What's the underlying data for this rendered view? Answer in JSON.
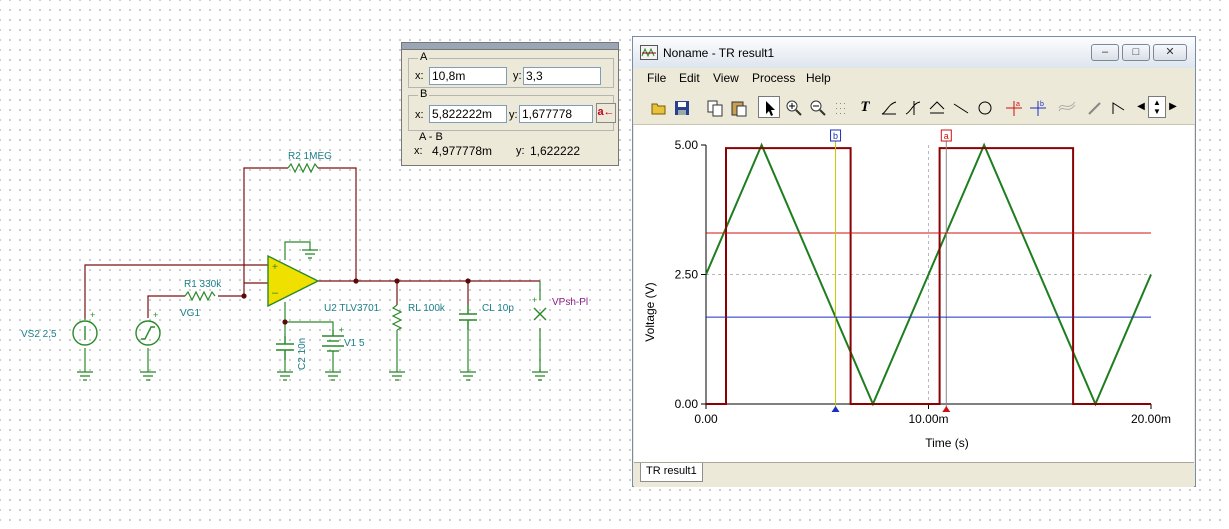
{
  "schematic": {
    "labels": {
      "r2": "R2 1MEG",
      "r1": "R1 330k",
      "vg1": "VG1",
      "vs2": "VS2 2,5",
      "u2": "U2 TLV3701",
      "rl": "RL 100k",
      "cl": "CL 10p",
      "vpsh": "VPsh-Pl",
      "c2": "C2 10n",
      "v1": "V1 5"
    }
  },
  "cursor_dialog": {
    "a": {
      "title": "A",
      "x_label": "x:",
      "x_value": "10,8m",
      "y_label": "y:",
      "y_value": "3,3"
    },
    "b": {
      "title": "B",
      "x_label": "x:",
      "x_value": "5,822222m",
      "y_label": "y:",
      "y_value": "1,677778",
      "button": "a←"
    },
    "ab": {
      "title": "A - B",
      "x_label": "x:",
      "x_value": "4,977778m",
      "y_label": "y:",
      "y_value": "1,622222"
    }
  },
  "window": {
    "title": "Noname - TR result1",
    "controls": {
      "minimize": "–",
      "maximize": "□",
      "close": "✕"
    },
    "menu": [
      "File",
      "Edit",
      "View",
      "Process",
      "Help"
    ],
    "toolbar": [
      "open-icon",
      "save-icon",
      "copy-icon",
      "paste-icon",
      "pointer-icon",
      "zoom-in-icon",
      "zoom-out-icon",
      "grid-icon",
      "text-icon",
      "curve-a-icon",
      "curve-b-icon",
      "curve-c-icon",
      "line-icon",
      "circle-icon",
      "cursor-a-icon",
      "cursor-b-icon",
      "wave-icon",
      "marker-icon",
      "step-icon",
      "scroll-left-icon",
      "scroll-updown-icon",
      "scroll-right-icon"
    ],
    "tab": "TR result1"
  },
  "colors": {
    "input_wave": "#1e7d1e",
    "output_wave": "#8b0000",
    "cursor_a": "#d01010",
    "cursor_b": "#1a2fbf",
    "label_teal": "#1a7f88"
  },
  "chart_data": {
    "type": "line",
    "xlabel": "Time (s)",
    "ylabel": "Voltage (V)",
    "x_ticks": [
      "0.00",
      "10.00m",
      "20.00m"
    ],
    "y_ticks": [
      "0.00",
      "2.50",
      "5.00"
    ],
    "xlim": [
      0,
      0.02
    ],
    "ylim": [
      0,
      5
    ],
    "grid": true,
    "series": [
      {
        "values": [
          [
            0,
            2.5
          ],
          [
            0.0025,
            5
          ],
          [
            0.0075,
            0
          ],
          [
            0.0125,
            5
          ],
          [
            0.0175,
            0
          ],
          [
            0.02,
            2.5
          ]
        ]
      },
      {
        "values": [
          [
            0,
            0
          ],
          [
            0.0009,
            0
          ],
          [
            0.0009,
            4.94
          ],
          [
            0.0065,
            4.94
          ],
          [
            0.0065,
            0
          ],
          [
            0.0105,
            0
          ],
          [
            0.0105,
            4.94
          ],
          [
            0.0165,
            4.94
          ],
          [
            0.0165,
            0
          ],
          [
            0.02,
            0
          ]
        ]
      }
    ],
    "cursors": [
      {
        "name": "a",
        "x": 0.0108,
        "y": 3.3
      },
      {
        "name": "b",
        "x": 0.005822222,
        "y": 1.677778
      }
    ]
  }
}
